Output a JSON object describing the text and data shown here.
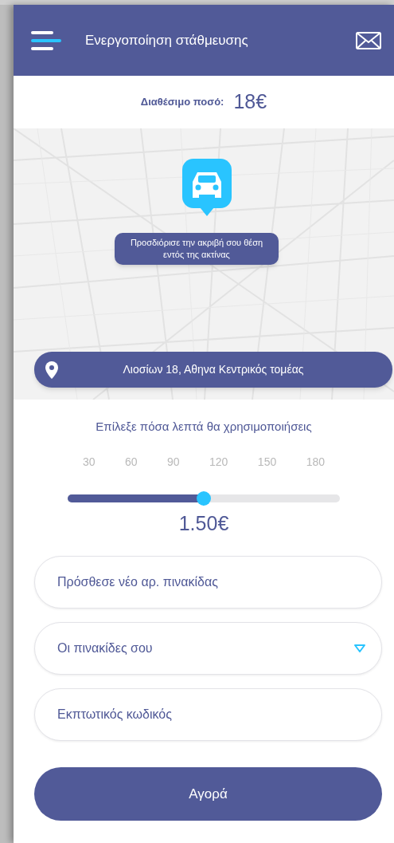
{
  "header": {
    "title": "Ενεργοποίηση στάθμευσης"
  },
  "balance": {
    "label": "Διαθέσιμο ποσό:",
    "amount": "18€"
  },
  "map": {
    "hint": "Προσδιόρισε την ακριβή σου θέση εντός της ακτίνας",
    "address": "Λιοσίων 18, Αθηνα Κεντρικός τομέας"
  },
  "duration": {
    "title": "Επίλεξε πόσα λεπτά θα χρησιμοποιήσεις",
    "ticks": [
      "30",
      "60",
      "90",
      "120",
      "150",
      "180"
    ],
    "level": 0.5,
    "price": "1.50€"
  },
  "fields": [
    {
      "kind": "input",
      "placeholder": "Πρόσθεσε νέο αρ. πινακίδας"
    },
    {
      "kind": "dropdown",
      "placeholder": "Οι πινακίδες σου"
    },
    {
      "kind": "input",
      "placeholder": "Εκπτωτικός κωδικός"
    }
  ],
  "buy_button": "Αγορά"
}
